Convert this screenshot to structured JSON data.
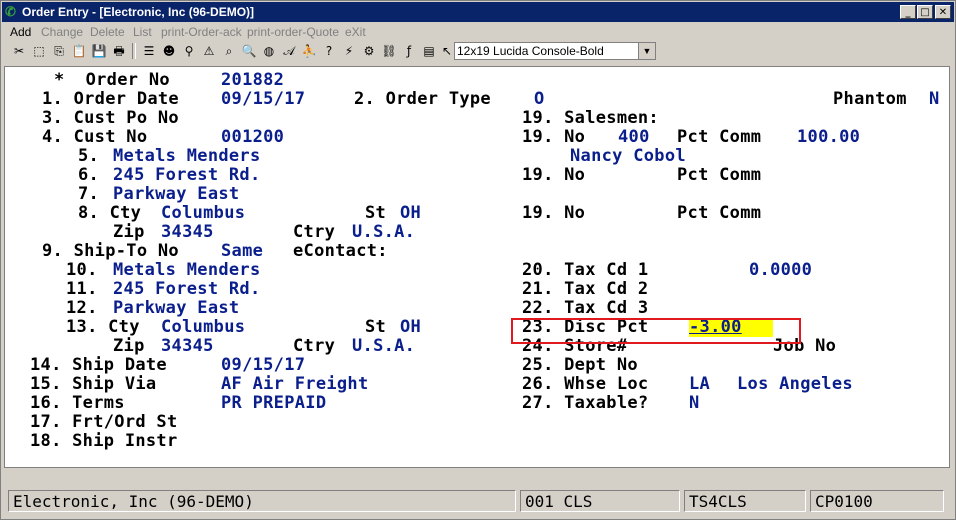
{
  "window": {
    "title": "Order Entry - [Electronic, Inc (96-DEMO)]",
    "minimize": "_",
    "restore": "□",
    "close": "✕"
  },
  "menu": {
    "add": "Add",
    "change": "Change",
    "delete": "Delete",
    "list": "List",
    "print_ack": "print-Order-ack",
    "print_quote": "print-order-Quote",
    "exit": "eXit"
  },
  "toolbar": {
    "font": "12x19 Lucida Console-Bold"
  },
  "form": {
    "order_no_label": "*  Order No",
    "order_no": "201882",
    "order_date_label": "1. Order Date",
    "order_date": "09/15/17",
    "order_type_label": "2. Order Type",
    "order_type": "O",
    "phantom_label": "Phantom",
    "phantom": "N",
    "cust_po_label": "3. Cust Po No",
    "cust_no_label": "4. Cust No",
    "cust_no": "001200",
    "bill_name_label": "5.",
    "bill_name": "Metals Menders",
    "bill_addr1_label": "6.",
    "bill_addr1": "245 Forest Rd.",
    "bill_addr2_label": "7.",
    "bill_addr2": "Parkway East",
    "bill_cty_label": "8. Cty",
    "bill_city": "Columbus",
    "bill_st_label": "St",
    "bill_state": "OH",
    "bill_zip_label": "Zip",
    "bill_zip": "34345",
    "bill_ctry_label": "Ctry",
    "bill_country": "U.S.A.",
    "shipto_label": "9. Ship-To No",
    "shipto": "Same",
    "econtact_label": "eContact:",
    "ship_name_label": "10.",
    "ship_name": "Metals Menders",
    "ship_addr1_label": "11.",
    "ship_addr1": "245 Forest Rd.",
    "ship_addr2_label": "12.",
    "ship_addr2": "Parkway East",
    "ship_cty_label": "13. Cty",
    "ship_city": "Columbus",
    "ship_st_label": "St",
    "ship_state": "OH",
    "ship_zip_label": "Zip",
    "ship_zip": "34345",
    "ship_ctry_label": "Ctry",
    "ship_country": "U.S.A.",
    "ship_date_label": "14. Ship Date",
    "ship_date": "09/15/17",
    "ship_via_label": "15. Ship Via",
    "ship_via": "AF Air Freight",
    "terms_label": "16. Terms",
    "terms": "PR PREPAID",
    "frt_label": "17. Frt/Ord St",
    "instr_label": "18. Ship Instr",
    "salesmen_label": "19. Salesmen:",
    "sm1_no_label": "19. No",
    "sm1_no": "400",
    "sm1_pct_label": "Pct Comm",
    "sm1_pct": "100.00",
    "sm1_name": "Nancy Cobol",
    "sm2_label": "19. No",
    "sm2_pct_label": "Pct Comm",
    "sm3_label": "19. No",
    "sm3_pct_label": "Pct Comm",
    "tax1_label": "20. Tax Cd 1",
    "tax1_rate": "0.0000",
    "tax2_label": "21. Tax Cd 2",
    "tax3_label": "22. Tax Cd 3",
    "disc_label": "23. Disc Pct",
    "disc": "-3.00",
    "store_label": "24. Store#",
    "job_label": "Job No",
    "dept_label": "25. Dept No",
    "whse_label": "26. Whse Loc",
    "whse_code": "LA",
    "whse_name": "Los Angeles",
    "taxable_label": "27. Taxable?",
    "taxable": "N"
  },
  "status": {
    "company": "Electronic, Inc (96-DEMO)",
    "user": "001 CLS",
    "terminal": "TS4CLS",
    "program": "CP0100"
  }
}
